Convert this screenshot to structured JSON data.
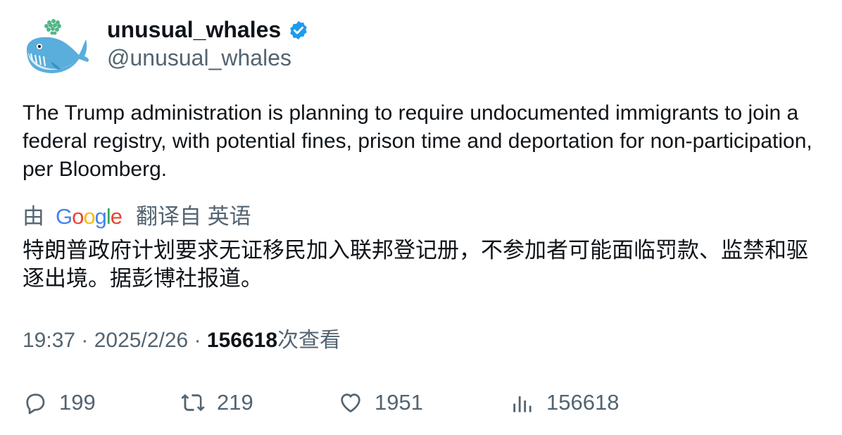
{
  "tweet": {
    "display_name": "unusual_whales",
    "handle": "@unusual_whales",
    "text": "The Trump administration is planning to require undocumented immigrants to join a federal registry, with potential fines, prison time and deportation for non-participation, per Bloomberg.",
    "translation": {
      "prefix": "由",
      "provider": "Google",
      "suffix": "翻译自 英语",
      "text": "特朗普政府计划要求无证移民加入联邦登记册，不参加者可能面临罚款、监禁和驱逐出境。据彭博社报道。"
    },
    "meta": {
      "time": "19:37",
      "date": "2025/2/26",
      "views": "156618",
      "views_label": "次查看",
      "separator": "·"
    },
    "actions": {
      "replies": "199",
      "retweets": "219",
      "likes": "1951",
      "views": "156618"
    }
  },
  "colors": {
    "primary_text": "#0f1419",
    "secondary_text": "#536471",
    "verified_blue": "#1d9bf0"
  },
  "icons": {
    "avatar": "whale-avatar",
    "verified": "verified-badge-icon",
    "reply": "reply-icon",
    "retweet": "retweet-icon",
    "like": "heart-icon",
    "views": "analytics-icon"
  }
}
